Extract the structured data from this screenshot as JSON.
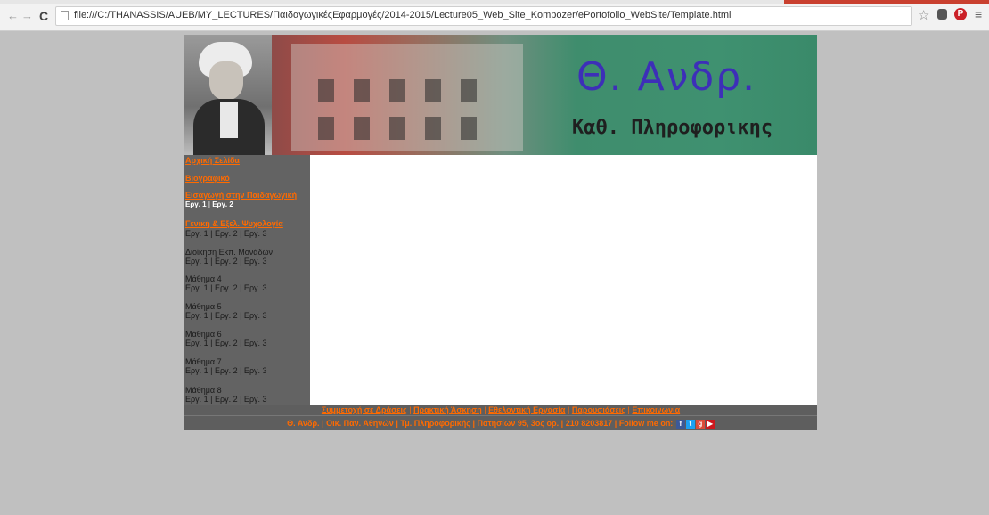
{
  "browser": {
    "url": "file:///C:/THANASSIS/AUEB/MY_LECTURES/ΠαιδαγωγικέςΕφαρμογές/2014-2015/Lecture05_Web_Site_Kompozer/ePortofolio_WebSite/Template.html",
    "icons": [
      "back-icon",
      "forward-icon",
      "reload-icon",
      "page-icon",
      "star-icon",
      "extension-icon",
      "pinterest-icon",
      "menu-icon"
    ]
  },
  "banner": {
    "title": "Θ. Ανδρ.",
    "subtitle": "Καθ. Πληροφορικης"
  },
  "sidebar": {
    "home": "Αρχική Σελίδα",
    "bio": "Βιογραφικό",
    "intro_pedagogy": "Εισαγωγή στην Παιδαγωγική",
    "intro_sub": [
      "Εργ. 1",
      "Εργ. 2"
    ],
    "psychology": "Γενική & Εξελ. Ψυχολογία",
    "sub3": "Εργ. 1 | Εργ. 2 | Εργ. 3",
    "admin": "Διοίκηση Εκπ. Μονάδων",
    "lesson4": "Μάθημα 4",
    "lesson5": "Μάθημα 5",
    "lesson6": "Μάθημα 6",
    "lesson7": "Μάθημα 7",
    "lesson8": "Μάθημα 8"
  },
  "footer": {
    "links": [
      "Συμμετοχή σε Δράσεις",
      "Πρακτική Άσκηση",
      "Εθελοντική Εργασία",
      "Παρουσιάσεις",
      "Επικοινωνία"
    ],
    "info": [
      "Θ. Ανδρ.",
      "Οικ. Παν. Αθηνών",
      "Τμ. Πληροφορικής",
      "Πατησίων 95, 3ος ορ.",
      "210 8203817",
      "Follow me on:"
    ],
    "social": [
      "facebook-icon",
      "twitter-icon",
      "google-plus-icon",
      "youtube-icon"
    ],
    "separator": "|"
  }
}
